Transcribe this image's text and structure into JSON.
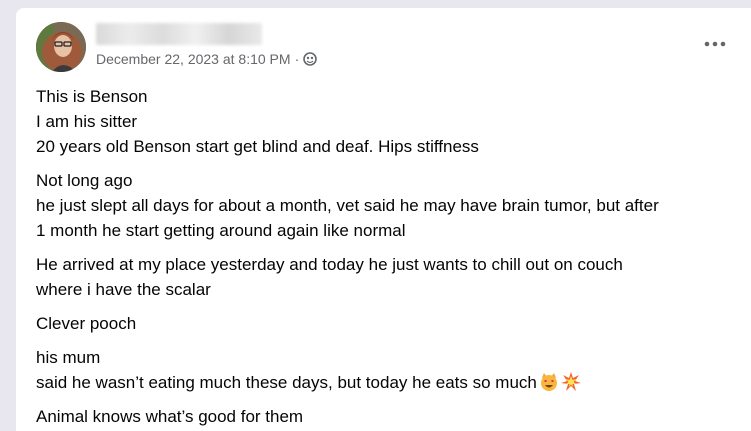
{
  "post": {
    "author_name": "",
    "date": "December 22, 2023 at 8:10 PM",
    "separator": "·",
    "audience_icon": "globe-icon",
    "more_icon": "more-options-icon",
    "paragraphs": [
      {
        "lines": [
          "This is Benson",
          "I am his sitter",
          "20 years old Benson start get blind and deaf.  Hips stiffness"
        ]
      },
      {
        "lines": [
          "Not long ago",
          "he just slept all days for about a month, vet said he may have brain tumor, but after",
          "1 month he start getting around again like normal"
        ]
      },
      {
        "lines": [
          "He arrived at my place yesterday and today he just wants to chill out on couch",
          "where i have the scalar"
        ]
      },
      {
        "lines": [
          "Clever pooch"
        ]
      },
      {
        "lines": [
          "his mum",
          "said he wasn’t eating much these days, but today he eats so much"
        ]
      },
      {
        "lines": [
          "Animal knows what’s good for them"
        ]
      }
    ],
    "emojis": [
      "smiling-cat-heart-eyes-emoji",
      "collision-emoji"
    ]
  },
  "colors": {
    "background": "#e8e6ee",
    "card": "#ffffff",
    "text": "#050505",
    "secondary_text": "#65676b"
  }
}
